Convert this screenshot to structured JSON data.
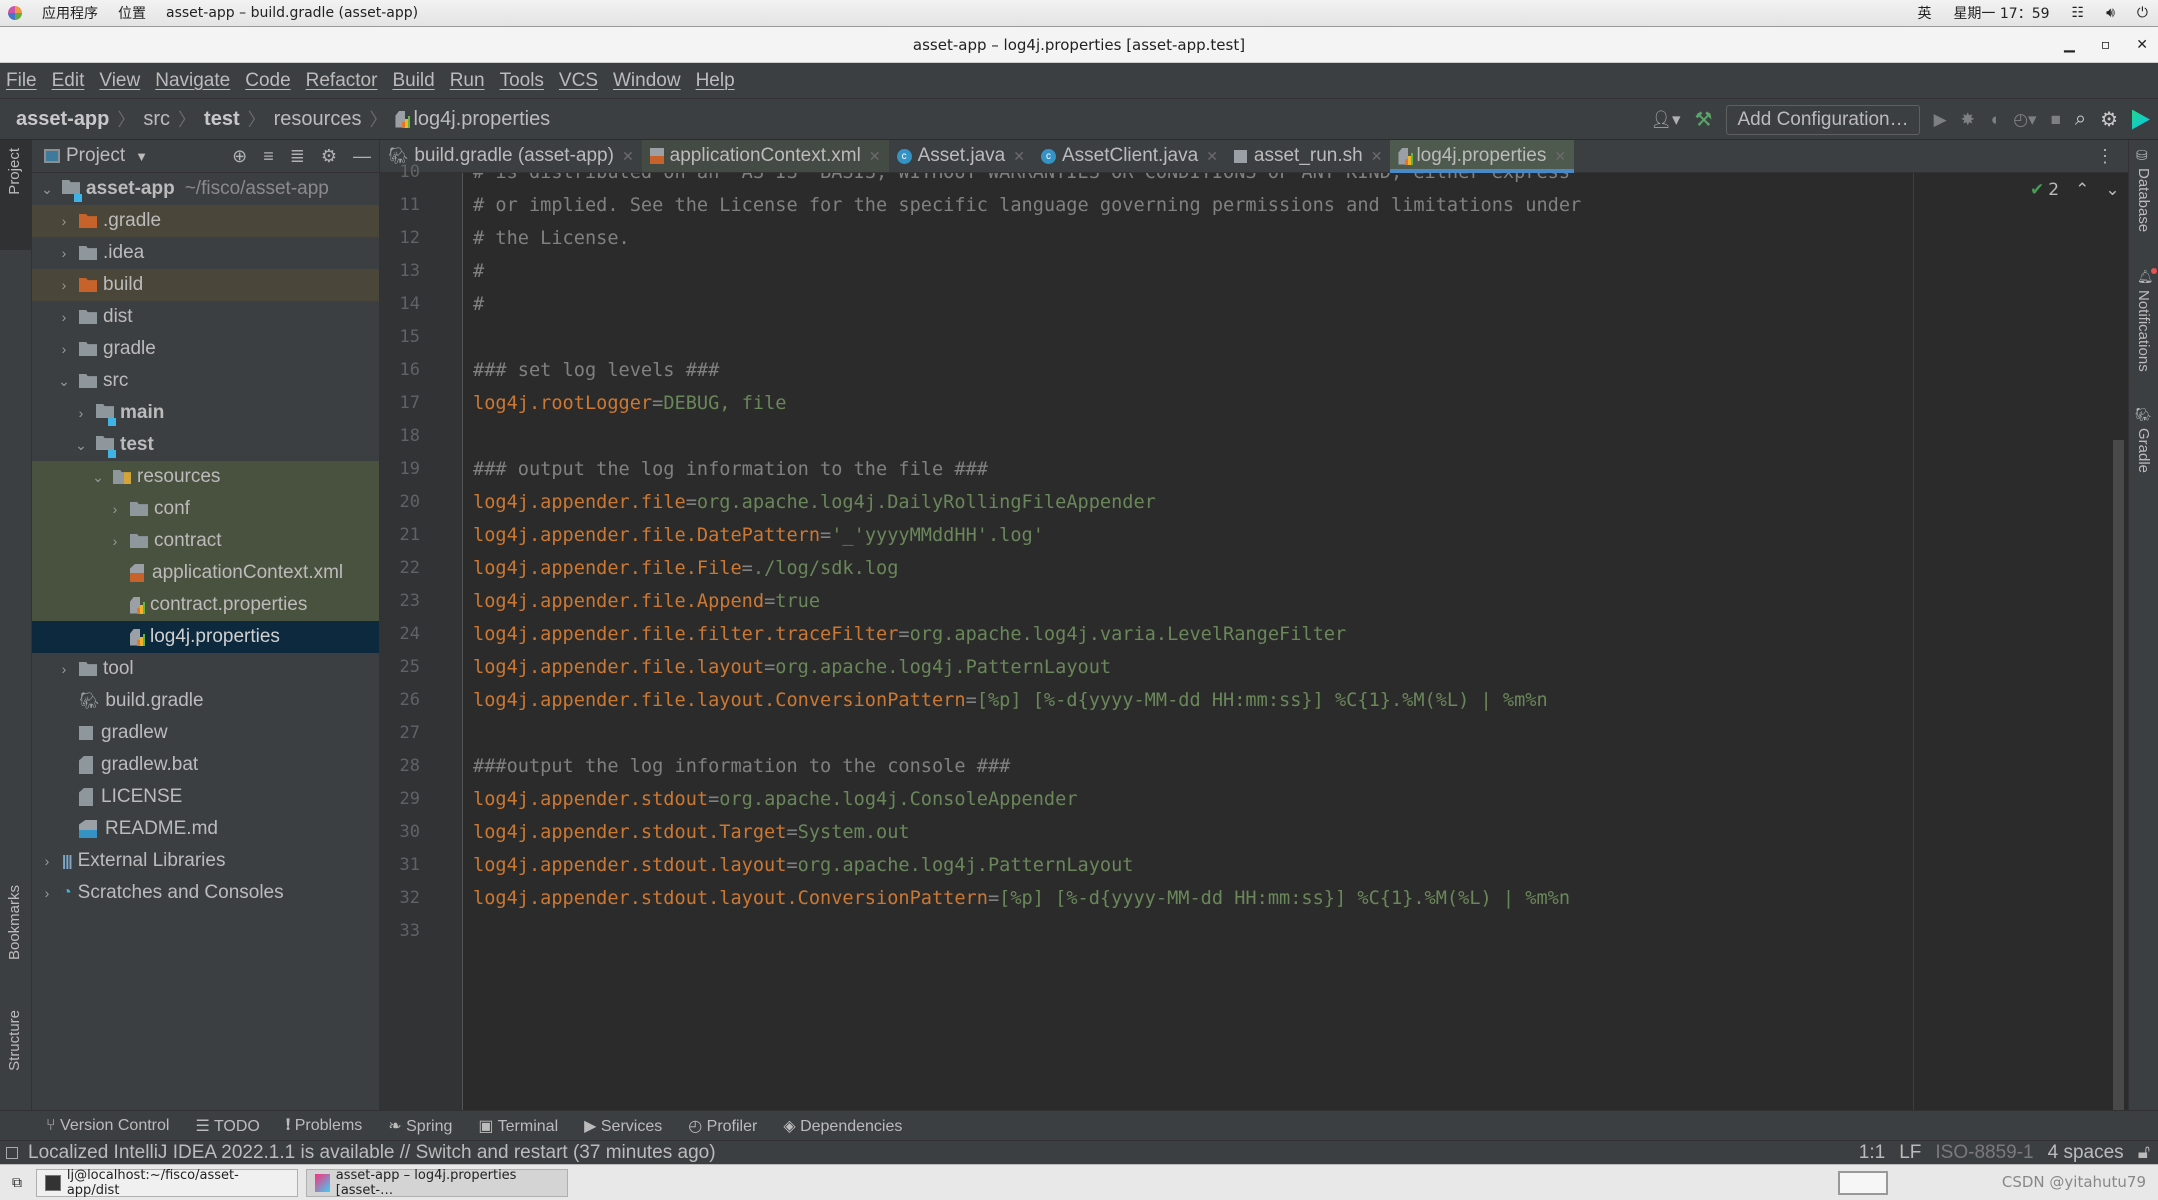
{
  "os_bar": {
    "apps_label": "应用程序",
    "places_label": "位置",
    "active_window": "asset-app – build.gradle (asset-app)",
    "input_method": "英",
    "datetime": "星期一 17：59"
  },
  "window": {
    "title": "asset-app – log4j.properties [asset-app.test]"
  },
  "menu": [
    "File",
    "Edit",
    "View",
    "Navigate",
    "Code",
    "Refactor",
    "Build",
    "Run",
    "Tools",
    "VCS",
    "Window",
    "Help"
  ],
  "breadcrumb": [
    "asset-app",
    "src",
    "test",
    "resources",
    "log4j.properties"
  ],
  "toolbar": {
    "add_configuration": "Add Configuration…"
  },
  "project_panel": {
    "title": "Project",
    "tree": [
      {
        "label": "asset-app",
        "extra": "~/fisco/asset-app",
        "level": 0,
        "type": "module",
        "expanded": true
      },
      {
        "label": ".gradle",
        "level": 1,
        "type": "folder-excluded",
        "expanded": false
      },
      {
        "label": ".idea",
        "level": 1,
        "type": "folder",
        "expanded": false
      },
      {
        "label": "build",
        "level": 1,
        "type": "folder-excluded",
        "expanded": false
      },
      {
        "label": "dist",
        "level": 1,
        "type": "folder",
        "expanded": false
      },
      {
        "label": "gradle",
        "level": 1,
        "type": "folder",
        "expanded": false
      },
      {
        "label": "src",
        "level": 1,
        "type": "folder",
        "expanded": true
      },
      {
        "label": "main",
        "level": 2,
        "type": "module",
        "expanded": false
      },
      {
        "label": "test",
        "level": 2,
        "type": "module",
        "expanded": true
      },
      {
        "label": "resources",
        "level": 3,
        "type": "resources",
        "expanded": true
      },
      {
        "label": "conf",
        "level": 4,
        "type": "folder",
        "expanded": false
      },
      {
        "label": "contract",
        "level": 4,
        "type": "folder",
        "expanded": false
      },
      {
        "label": "applicationContext.xml",
        "level": 4,
        "type": "xml-file"
      },
      {
        "label": "contract.properties",
        "level": 4,
        "type": "properties-file"
      },
      {
        "label": "log4j.properties",
        "level": 4,
        "type": "properties-file",
        "selected": true
      },
      {
        "label": "tool",
        "level": 1,
        "type": "folder",
        "expanded": false
      },
      {
        "label": "build.gradle",
        "level": 1,
        "type": "gradle-file"
      },
      {
        "label": "gradlew",
        "level": 1,
        "type": "shell-file"
      },
      {
        "label": "gradlew.bat",
        "level": 1,
        "type": "text-file"
      },
      {
        "label": "LICENSE",
        "level": 1,
        "type": "text-file"
      },
      {
        "label": "README.md",
        "level": 1,
        "type": "md-file"
      },
      {
        "label": "External Libraries",
        "level": 0,
        "type": "libraries",
        "expanded": false
      },
      {
        "label": "Scratches and Consoles",
        "level": 0,
        "type": "scratches",
        "expanded": false
      }
    ]
  },
  "left_stripe": {
    "project": "Project",
    "bookmarks": "Bookmarks",
    "structure": "Structure"
  },
  "right_stripe": {
    "database": "Database",
    "notifications": "Notifications",
    "gradle": "Gradle"
  },
  "tabs": [
    {
      "label": "build.gradle (asset-app)",
      "icon": "gradle"
    },
    {
      "label": "applicationContext.xml",
      "icon": "xml"
    },
    {
      "label": "Asset.java",
      "icon": "class"
    },
    {
      "label": "AssetClient.java",
      "icon": "class-run"
    },
    {
      "label": "asset_run.sh",
      "icon": "shell"
    },
    {
      "label": "log4j.properties",
      "icon": "properties",
      "active": true
    }
  ],
  "editor": {
    "inspection_count": "2",
    "lines": [
      {
        "n": "10",
        "type": "comment",
        "text": "# is distributed on an \"AS IS\" BASIS, WITHOUT WARRANTIES OR CONDITIONS OF ANY KIND, either express"
      },
      {
        "n": "11",
        "type": "comment",
        "text": "# or implied. See the License for the specific language governing permissions and limitations under"
      },
      {
        "n": "12",
        "type": "comment",
        "text": "# the License."
      },
      {
        "n": "13",
        "type": "comment",
        "text": "#"
      },
      {
        "n": "14",
        "type": "comment",
        "text": "#"
      },
      {
        "n": "15",
        "type": "blank",
        "text": ""
      },
      {
        "n": "16",
        "type": "comment",
        "text": "### set log levels ###"
      },
      {
        "n": "17",
        "type": "prop",
        "key": "log4j.rootLogger",
        "value": "DEBUG, file"
      },
      {
        "n": "18",
        "type": "blank",
        "text": ""
      },
      {
        "n": "19",
        "type": "comment",
        "text": "### output the log information to the file ###"
      },
      {
        "n": "20",
        "type": "prop",
        "key": "log4j.appender.file",
        "value": "org.apache.log4j.DailyRollingFileAppender"
      },
      {
        "n": "21",
        "type": "prop",
        "key": "log4j.appender.file.DatePattern",
        "value": "'_'yyyyMMddHH'.log'"
      },
      {
        "n": "22",
        "type": "prop",
        "key": "log4j.appender.file.File",
        "value": "./log/sdk.log"
      },
      {
        "n": "23",
        "type": "prop",
        "key": "log4j.appender.file.Append",
        "value": "true"
      },
      {
        "n": "24",
        "type": "prop",
        "key": "log4j.appender.file.filter.traceFilter",
        "value": "org.apache.log4j.varia.LevelRangeFilter"
      },
      {
        "n": "25",
        "type": "prop",
        "key": "log4j.appender.file.layout",
        "value": "org.apache.log4j.PatternLayout"
      },
      {
        "n": "26",
        "type": "prop",
        "key": "log4j.appender.file.layout.ConversionPattern",
        "value": "[%p] [%-d{yyyy-MM-dd HH:mm:ss}] %C{1}.%M(%L) | %m%n"
      },
      {
        "n": "27",
        "type": "blank",
        "text": ""
      },
      {
        "n": "28",
        "type": "comment",
        "text": "###output the log information to the console ###"
      },
      {
        "n": "29",
        "type": "prop",
        "key": "log4j.appender.stdout",
        "value": "org.apache.log4j.ConsoleAppender"
      },
      {
        "n": "30",
        "type": "prop",
        "key": "log4j.appender.stdout.Target",
        "value": "System.out"
      },
      {
        "n": "31",
        "type": "prop",
        "key": "log4j.appender.stdout.layout",
        "value": "org.apache.log4j.PatternLayout"
      },
      {
        "n": "32",
        "type": "prop",
        "key": "log4j.appender.stdout.layout.ConversionPattern",
        "value": "[%p] [%-d{yyyy-MM-dd HH:mm:ss}] %C{1}.%M(%L) | %m%n"
      },
      {
        "n": "33",
        "type": "blank",
        "text": ""
      }
    ]
  },
  "bottom_tools": [
    "Version Control",
    "TODO",
    "Problems",
    "Spring",
    "Terminal",
    "Services",
    "Profiler",
    "Dependencies"
  ],
  "status": {
    "message": "Localized IntelliJ IDEA 2022.1.1 is available // Switch and restart (37 minutes ago)",
    "position": "1:1",
    "line_sep": "LF",
    "encoding": "ISO-8859-1",
    "indent": "4 spaces"
  },
  "taskbar": {
    "items": [
      {
        "label": "lj@localhost:~/fisco/asset-app/dist",
        "icon": "terminal"
      },
      {
        "label": "asset-app – log4j.properties [asset-…",
        "icon": "intellij",
        "active": true
      }
    ],
    "watermark": "CSDN @yitahutu79"
  }
}
